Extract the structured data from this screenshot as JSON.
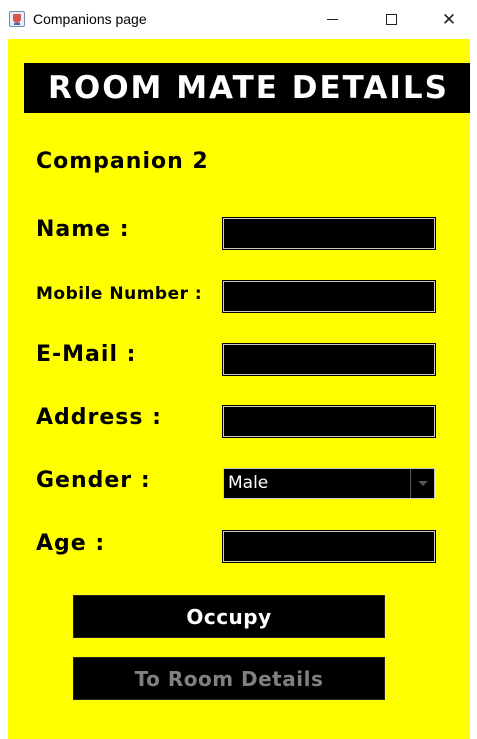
{
  "window": {
    "title": "Companions page",
    "controls": {
      "minimize": "minimize-icon",
      "maximize": "maximize-icon",
      "close": "close-icon"
    }
  },
  "header": {
    "title": "ROOM MATE DETAILS"
  },
  "subheading": "Companion 2",
  "form": {
    "name_label": "Name :",
    "name_value": "",
    "mobile_label": "Mobile Number :",
    "mobile_value": "",
    "email_label": "E-Mail :",
    "email_value": "",
    "address_label": "Address :",
    "address_value": "",
    "gender_label": "Gender :",
    "gender_value": "Male",
    "age_label": "Age :",
    "age_value": ""
  },
  "buttons": {
    "occupy": "Occupy",
    "room_details": "To Room Details"
  },
  "colors": {
    "background": "#ffff00",
    "panel": "#000000",
    "text_light": "#ffffff",
    "disabled_text": "#808080"
  }
}
